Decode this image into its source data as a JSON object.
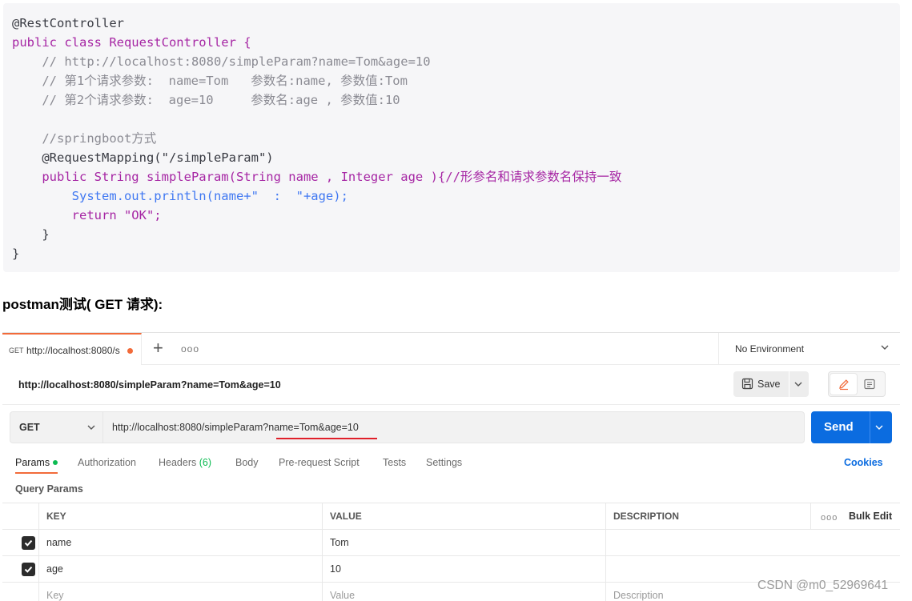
{
  "code": {
    "lines": [
      "@RestController",
      "public class RequestController {",
      "    // http://localhost:8080/simpleParam?name=Tom&age=10",
      "    // 第1个请求参数:  name=Tom   参数名:name, 参数值:Tom",
      "    // 第2个请求参数:  age=10     参数名:age , 参数值:10",
      "",
      "    //springboot方式",
      "    @RequestMapping(\"/simpleParam\")",
      "    public String simpleParam(String name , Integer age ){//形参名和请求参数名保持一致",
      "        System.out.println(name+\"  :  \"+age);",
      "        return \"OK\";",
      "    }",
      "}"
    ]
  },
  "heading": "postman测试( GET 请求):",
  "postman": {
    "tab": {
      "method": "GET",
      "url": "http://localhost:8080/s"
    },
    "environment": "No Environment",
    "request_title": "http://localhost:8080/simpleParam?name=Tom&age=10",
    "save_label": "Save",
    "method": "GET",
    "url": "http://localhost:8080/simpleParam?name=Tom&age=10",
    "send_label": "Send",
    "tabs": {
      "params": "Params",
      "authorization": "Authorization",
      "headers": "Headers",
      "headers_count": "(6)",
      "body": "Body",
      "pre_request": "Pre-request Script",
      "tests": "Tests",
      "settings": "Settings"
    },
    "cookies": "Cookies",
    "query_params_title": "Query Params",
    "table": {
      "headers": {
        "key": "KEY",
        "value": "VALUE",
        "description": "DESCRIPTION",
        "bulk_edit": "Bulk Edit"
      },
      "rows": [
        {
          "checked": true,
          "key": "name",
          "value": "Tom",
          "description": ""
        },
        {
          "checked": true,
          "key": "age",
          "value": "10",
          "description": ""
        }
      ],
      "placeholder": {
        "key": "Key",
        "value": "Value",
        "description": "Description"
      }
    }
  },
  "watermark": "CSDN @m0_52969641",
  "colors": {
    "accent": "#f26b3a",
    "send": "#0b6ce0",
    "active_dot": "#0cbb52",
    "underline": "#e0202a"
  }
}
